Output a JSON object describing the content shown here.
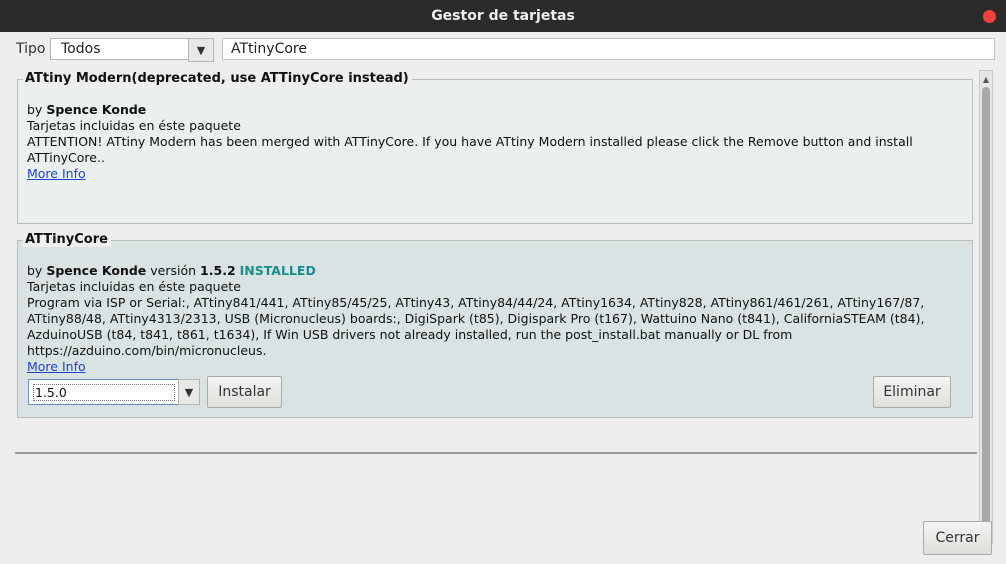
{
  "window": {
    "title": "Gestor de tarjetas",
    "close_color": "#f0413e"
  },
  "filter": {
    "tipo_label": "Tipo",
    "type_value": "Todos",
    "search_value": "ATtinyCore"
  },
  "boards": [
    {
      "title": "ATtiny Modern(deprecated, use ATTinyCore instead)",
      "by": "by",
      "author": "Spence Konde",
      "included": "Tarjetas incluidas en éste paquete",
      "description_l1": "ATTENTION! ATtiny Modern has been merged with ATTinyCore. If you have ATtiny Modern installed please click the Remove button and install",
      "description_l2": "ATTinyCore..",
      "more_info": "More Info"
    },
    {
      "title": "ATTinyCore",
      "by": "by",
      "author": "Spence Konde",
      "version_word": "versión",
      "version": "1.5.2",
      "status": "INSTALLED",
      "included": "Tarjetas incluidas en éste paquete",
      "description_l1": "Program via ISP or Serial:, ATtiny841/441, ATtiny85/45/25, ATtiny43, ATtiny84/44/24, ATtiny1634, ATtiny828, ATtiny861/461/261, ATtiny167/87,",
      "description_l2": "ATtiny88/48, ATtiny4313/2313, USB (Micronucleus) boards:, DigiSpark (t85), Digispark Pro (t167), Wattuino Nano (t841), CaliforniaSTEAM (t84),",
      "description_l3": "AzduinoUSB (t84, t841, t861, t1634), If Win USB drivers not already installed, run the post_install.bat manually or DL from",
      "description_l4": "https://azduino.com/bin/micronucleus.",
      "more_info": "More Info",
      "selected_version": "1.5.0",
      "install_label": "Instalar",
      "remove_label": "Eliminar"
    }
  ],
  "footer": {
    "close_label": "Cerrar"
  },
  "colors": {
    "installed": "#1a8c8c",
    "link": "#1d47c4",
    "board_selected_bg": "#dae3e3"
  }
}
